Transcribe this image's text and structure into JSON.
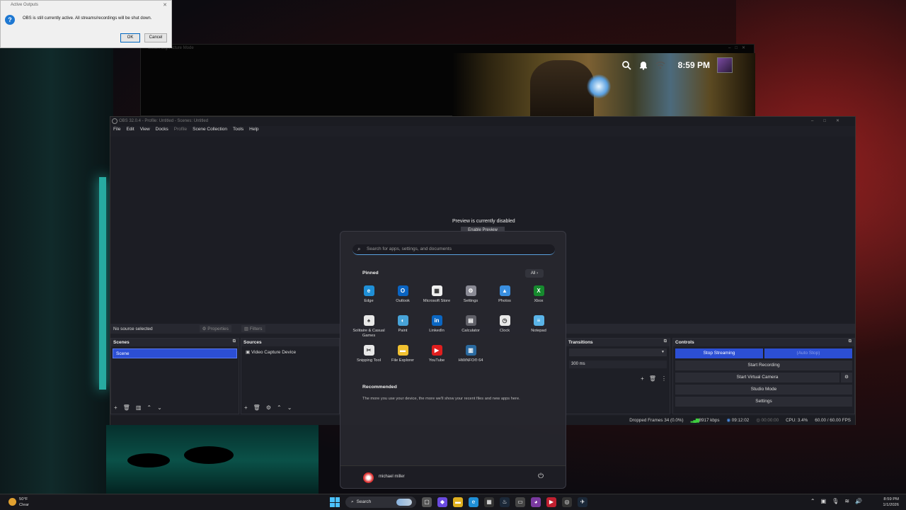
{
  "dialog": {
    "title": "Active Outputs",
    "message": "OBS is still currently active. All streams/recordings will be shut down.",
    "ok": "OK",
    "cancel": "Cancel"
  },
  "pip": {
    "title": "Steam Big Picture Mode",
    "time": "8:59 PM"
  },
  "obs": {
    "title": "OBS 32.0.4 - Profile: Untitled - Scenes: Untitled",
    "menu": [
      "File",
      "Edit",
      "View",
      "Docks",
      "Profile",
      "Scene Collection",
      "Tools",
      "Help"
    ],
    "preview_message": "Preview is currently disabled",
    "enable_preview": "Enable Preview",
    "no_source": "No source selected",
    "properties": "Properties",
    "filters": "Filters",
    "scenes_header": "Scenes",
    "scene_item": "Scene",
    "sources_header": "Sources",
    "source_item": "Video Capture Device",
    "transitions_header": "Transitions",
    "duration": "300 ms",
    "controls_header": "Controls",
    "stop_streaming": "Stop Streaming",
    "auto_stop": "(Auto Stop)",
    "start_recording": "Start Recording",
    "start_virtual_camera": "Start Virtual Camera",
    "studio_mode": "Studio Mode",
    "settings": "Settings",
    "status": {
      "dropped": "Dropped Frames 34 (0.0%)",
      "bitrate": "8917 kbps",
      "live_time": "09:12:02",
      "rec_time": "00:00:00",
      "cpu": "CPU: 3.4%",
      "fps": "60.00 / 60.00 FPS"
    }
  },
  "start_menu": {
    "search_placeholder": "Search for apps, settings, and documents",
    "pinned": "Pinned",
    "all": "All",
    "apps": [
      {
        "label": "Edge",
        "color": "#1f8fd6",
        "glyph": "e"
      },
      {
        "label": "Outlook",
        "color": "#0a64c2",
        "glyph": "O"
      },
      {
        "label": "Microsoft Store",
        "color": "#f0f0f0",
        "glyph": "▦"
      },
      {
        "label": "Settings",
        "color": "#8a8a94",
        "glyph": "⚙"
      },
      {
        "label": "Photos",
        "color": "#3a8fe0",
        "glyph": "▲"
      },
      {
        "label": "Xbox",
        "color": "#168a2e",
        "glyph": "X"
      },
      {
        "label": "Solitaire & Casual Games",
        "color": "#e8e8e8",
        "glyph": "♠"
      },
      {
        "label": "Paint",
        "color": "#47a3d8",
        "glyph": "◐"
      },
      {
        "label": "LinkedIn",
        "color": "#0a66c2",
        "glyph": "in"
      },
      {
        "label": "Calculator",
        "color": "#606068",
        "glyph": "▤"
      },
      {
        "label": "Clock",
        "color": "#e8e8e8",
        "glyph": "◷"
      },
      {
        "label": "Notepad",
        "color": "#5ab4e8",
        "glyph": "≡"
      },
      {
        "label": "Snipping Tool",
        "color": "#e8e8e8",
        "glyph": "✂"
      },
      {
        "label": "File Explorer",
        "color": "#f0c030",
        "glyph": "▬"
      },
      {
        "label": "YouTube",
        "color": "#e01e1e",
        "glyph": "▶"
      },
      {
        "label": "HWiNFO® 64",
        "color": "#2a6aa0",
        "glyph": "▥"
      }
    ],
    "recommended": "Recommended",
    "recommended_text": "The more you use your device, the more we'll show your recent files and new apps here.",
    "user": "michael miller"
  },
  "taskbar": {
    "temp": "50°F",
    "weather": "Clear",
    "search": "Search",
    "time": "8:59 PM",
    "date": "1/1/2026"
  }
}
